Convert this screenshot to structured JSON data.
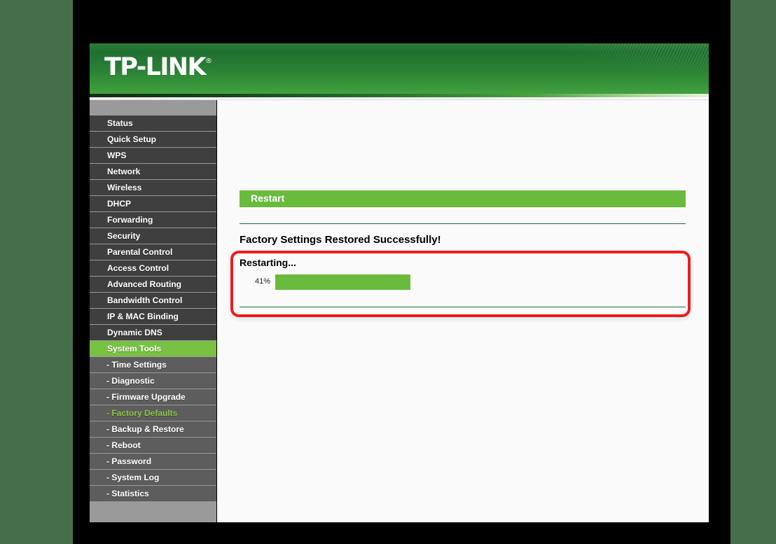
{
  "brand": {
    "logo_text": "TP-LINK",
    "trademark": "®"
  },
  "sidebar": {
    "items": [
      {
        "label": "Status",
        "type": "top",
        "state": "normal"
      },
      {
        "label": "Quick Setup",
        "type": "top",
        "state": "normal"
      },
      {
        "label": "WPS",
        "type": "top",
        "state": "normal"
      },
      {
        "label": "Network",
        "type": "top",
        "state": "normal"
      },
      {
        "label": "Wireless",
        "type": "top",
        "state": "normal"
      },
      {
        "label": "DHCP",
        "type": "top",
        "state": "normal"
      },
      {
        "label": "Forwarding",
        "type": "top",
        "state": "normal"
      },
      {
        "label": "Security",
        "type": "top",
        "state": "normal"
      },
      {
        "label": "Parental Control",
        "type": "top",
        "state": "normal"
      },
      {
        "label": "Access Control",
        "type": "top",
        "state": "normal"
      },
      {
        "label": "Advanced Routing",
        "type": "top",
        "state": "normal"
      },
      {
        "label": "Bandwidth Control",
        "type": "top",
        "state": "normal"
      },
      {
        "label": "IP & MAC Binding",
        "type": "top",
        "state": "normal"
      },
      {
        "label": "Dynamic DNS",
        "type": "top",
        "state": "normal"
      },
      {
        "label": "System Tools",
        "type": "top",
        "state": "active"
      },
      {
        "label": "- Time Settings",
        "type": "sub",
        "state": "normal"
      },
      {
        "label": "- Diagnostic",
        "type": "sub",
        "state": "normal"
      },
      {
        "label": "- Firmware Upgrade",
        "type": "sub",
        "state": "normal"
      },
      {
        "label": "- Factory Defaults",
        "type": "sub",
        "state": "subactive"
      },
      {
        "label": "- Backup & Restore",
        "type": "sub",
        "state": "normal"
      },
      {
        "label": "- Reboot",
        "type": "sub",
        "state": "normal"
      },
      {
        "label": "- Password",
        "type": "sub",
        "state": "normal"
      },
      {
        "label": "- System Log",
        "type": "sub",
        "state": "normal"
      },
      {
        "label": "- Statistics",
        "type": "sub",
        "state": "normal"
      }
    ]
  },
  "main": {
    "title": "Restart",
    "success_message": "Factory Settings Restored Successfully!",
    "restarting_label": "Restarting...",
    "progress": {
      "percent_label": "41%",
      "percent_value": 41
    }
  },
  "colors": {
    "brand_green": "#68bb3d",
    "header_green": "#2b8236",
    "active_menu": "#79c143",
    "sub_active_text": "#8ac63f",
    "divider_green": "#1d6b42",
    "annotation_red": "#ee1c1c",
    "page_background": "#fafafa",
    "outer_background": "#456f4a"
  }
}
